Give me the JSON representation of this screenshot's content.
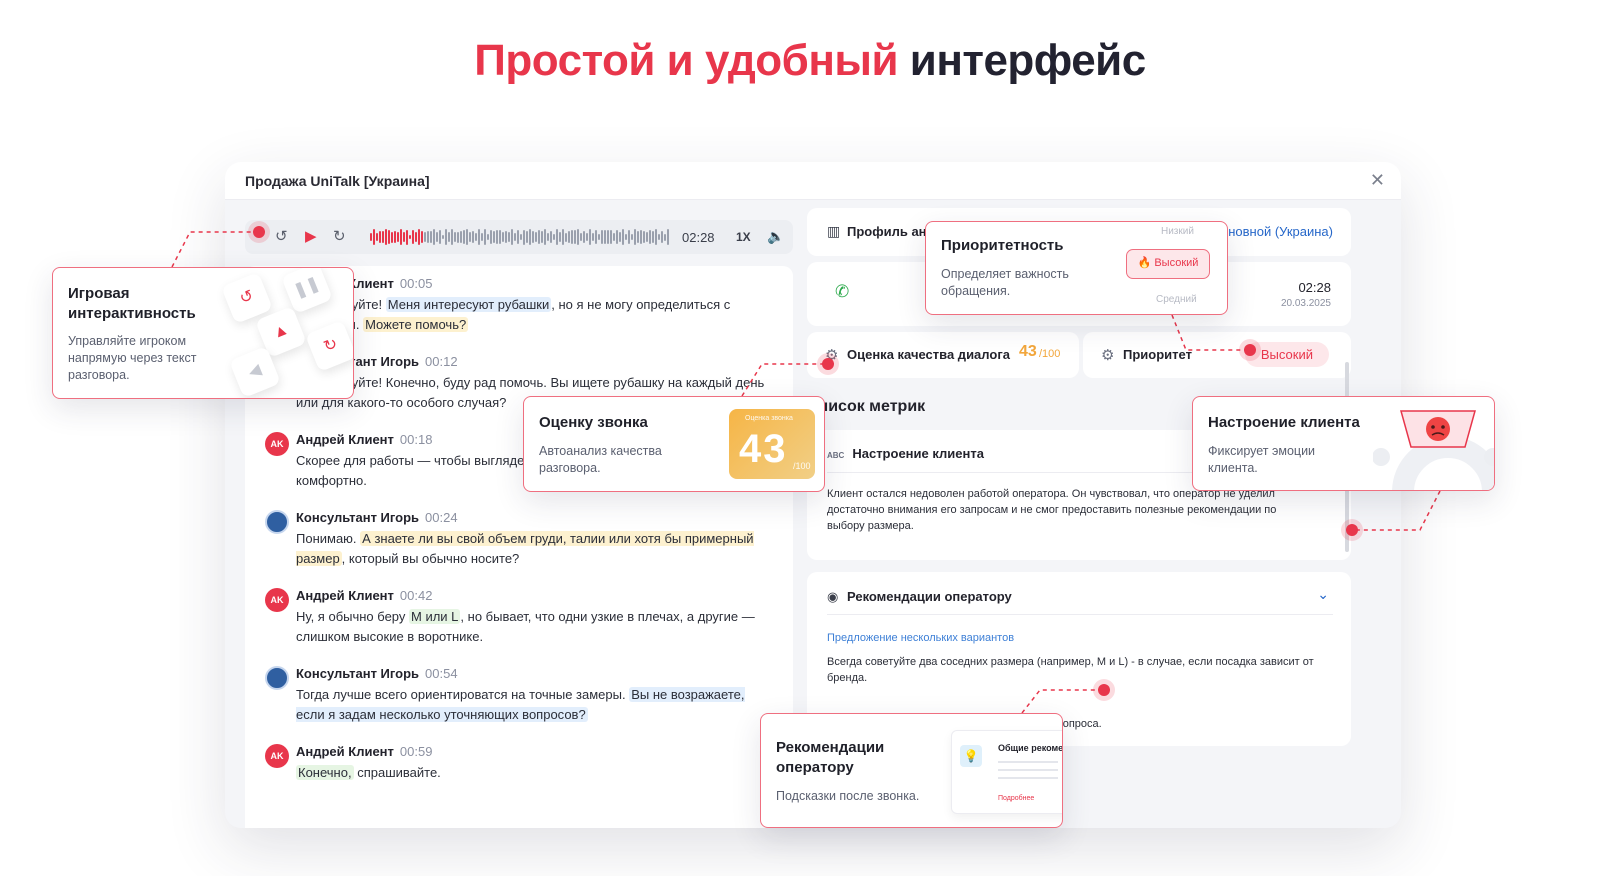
{
  "headline": {
    "accent": "Простой и удобный",
    "rest": "интерфейс"
  },
  "window": {
    "title": "Продажа UniTalk [Украина]",
    "close_icon": "close-icon"
  },
  "player": {
    "time": "02:28",
    "speed": "1X"
  },
  "chat": [
    {
      "role": "client",
      "initials": "AK",
      "name": "Андрей Клиент",
      "time": "00:05",
      "parts": [
        [
          "",
          "Здравствуйте! "
        ],
        [
          "blue",
          "Меня интересуют рубашки"
        ],
        [
          "",
          ", но я не могу определиться с размером. "
        ],
        [
          "yellow",
          "Можете помочь?"
        ]
      ]
    },
    {
      "role": "agent",
      "initials": "",
      "name": "Консультант Игорь",
      "time": "00:12",
      "parts": [
        [
          "",
          "Здравствуйте! Конечно, буду рад помочь. Вы ищете рубашку на каждый день или для какого-то особого случая?"
        ]
      ]
    },
    {
      "role": "client",
      "initials": "AK",
      "name": "Андрей Клиент",
      "time": "00:18",
      "parts": [
        [
          "",
          "Скорее для работы — чтобы выглядеть стильно и чувствовать себя комфортно."
        ]
      ]
    },
    {
      "role": "agent",
      "initials": "",
      "name": "Консультант Игорь",
      "time": "00:24",
      "parts": [
        [
          "",
          "Понимаю. "
        ],
        [
          "yellow",
          "А знаете ли вы свой объем груди, талии или хотя бы примерный размер"
        ],
        [
          "",
          ", который вы обычно носите?"
        ]
      ]
    },
    {
      "role": "client",
      "initials": "AK",
      "name": "Андрей Клиент",
      "time": "00:42",
      "parts": [
        [
          "",
          "Ну, я обычно беру "
        ],
        [
          "green",
          "M или L"
        ],
        [
          "",
          ", но бывает, что одни узкие в плечах, а другие — слишком высокие в воротнике."
        ]
      ]
    },
    {
      "role": "agent",
      "initials": "",
      "name": "Консультант Игорь",
      "time": "00:54",
      "parts": [
        [
          "",
          "Тогда лучше всего ориентироватся на точные замеры. "
        ],
        [
          "blue",
          "Вы не возражаете, если я задам несколько уточняющих вопросов?"
        ]
      ]
    },
    {
      "role": "client",
      "initials": "AK",
      "name": "Андрей Клиент",
      "time": "00:59",
      "parts": [
        [
          "green",
          "Конечно,"
        ],
        [
          "",
          " спрашивайте."
        ]
      ]
    }
  ],
  "profile": {
    "label": "Профиль анализа",
    "link": "Основной (Украина)"
  },
  "call": {
    "duration": "02:28",
    "date": "20.03.2025"
  },
  "quality": {
    "label": "Оценка качества диалога",
    "value": "43",
    "max": "/100",
    "color": "#f2a63b"
  },
  "priority": {
    "label": "Приоритет",
    "value": "Высокий",
    "color": "#e8364b"
  },
  "metrics": {
    "title": "Список метрик",
    "mood_title": "Настроение клиента",
    "mood_text": "Клиент остался недоволен работой оператора. Он чувствовал, что оператор не уделил достаточно внимания его запросам и не смог предоставить полезные рекомендации по выбору размера."
  },
  "recommendations": {
    "title": "Рекомендации оператору",
    "sub": "Предложение нескольких вариантов",
    "text": "Всегда советуйте два соседних размера (например, M и L) - в случае, если посадка зависит от бренда.",
    "tail": "вопроса."
  },
  "callouts": {
    "game": {
      "title": "Игровая интерактивность",
      "desc": "Управляйте игроком напрямую через текст разговора."
    },
    "prio": {
      "title": "Приоритетность",
      "desc": "Определяет важность обращения.",
      "low": "Низкий",
      "high": "Высокий",
      "mid": "Средний"
    },
    "score": {
      "title": "Оценку звонка",
      "desc": "Автоанализ качества разговора.",
      "tile_title": "Оценка звонка",
      "tile_value": "43",
      "tile_max": "/100"
    },
    "mood": {
      "title": "Настроение клиента",
      "desc": "Фиксирует эмоции клиента."
    },
    "rec": {
      "title": "Рекомендации оператору",
      "desc": "Подсказки после звонка.",
      "mini_title": "Общие рекомендации",
      "mini_more": "Подробнее"
    }
  }
}
